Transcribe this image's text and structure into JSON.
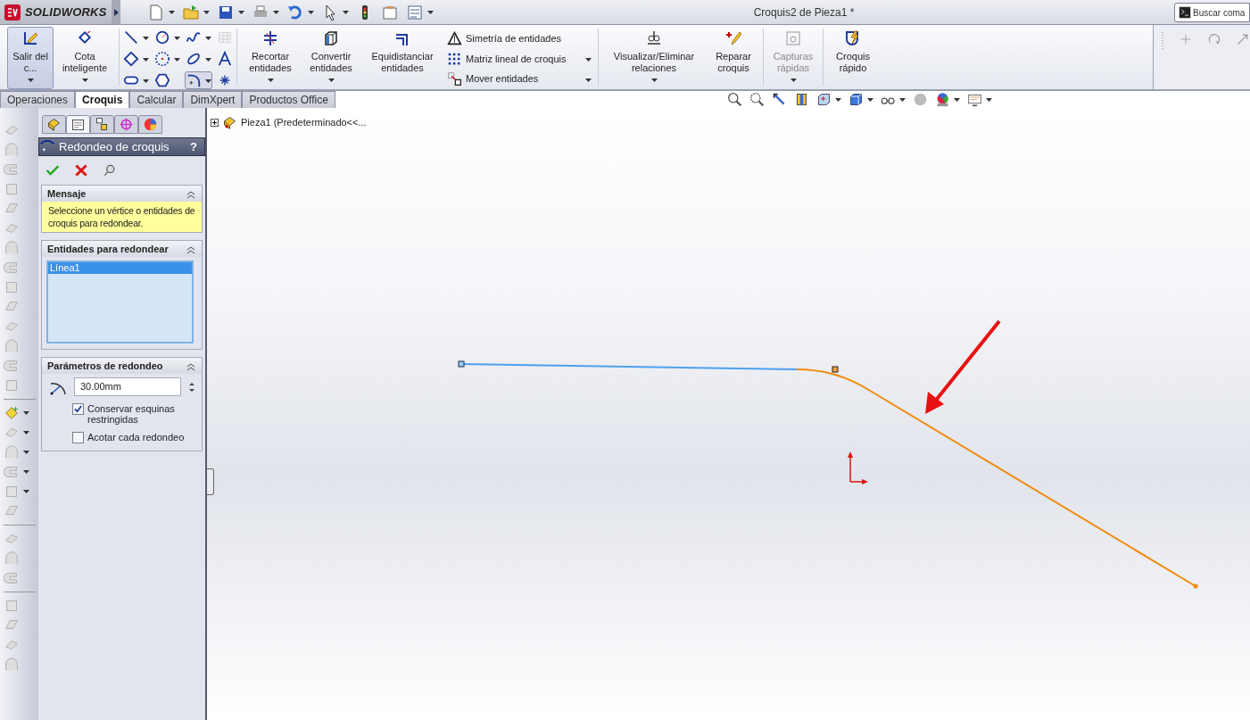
{
  "app": {
    "logo": "SOLIDWORKS"
  },
  "window": {
    "title": "Croquis2 de Pieza1 *"
  },
  "search": {
    "placeholder": "Buscar coma"
  },
  "ribbon": [
    {
      "kind": "large",
      "label": "Salir del c...",
      "pressed": true,
      "dropdown": true
    },
    {
      "kind": "large",
      "label": "Cota inteligente",
      "pressed": false,
      "dropdown": true
    },
    {
      "kind": "tools",
      "tools": [
        {
          "dropdown": true,
          "pressed": false
        },
        {
          "dropdown": true,
          "pressed": false
        },
        {
          "dropdown": true,
          "pressed": false
        },
        {
          "dropdown": false,
          "pressed": false
        },
        {
          "dropdown": true,
          "pressed": false
        },
        {
          "dropdown": true,
          "pressed": false
        },
        {
          "dropdown": true,
          "pressed": false
        },
        {
          "dropdown": false,
          "pressed": false
        },
        {
          "dropdown": true,
          "pressed": false
        },
        {
          "dropdown": false,
          "pressed": false
        },
        {
          "dropdown": true,
          "pressed": true
        },
        {
          "dropdown": false,
          "pressed": false
        }
      ]
    },
    {
      "kind": "large",
      "label": "Recortar entidades",
      "pressed": false,
      "dropdown": true
    },
    {
      "kind": "large",
      "label": "Convertir entidades",
      "pressed": false,
      "dropdown": true
    },
    {
      "kind": "large",
      "label": "Equidistanciar entidades",
      "pressed": false,
      "dropdown": false
    },
    {
      "kind": "list",
      "items": [
        {
          "label": "Simetría de entidades",
          "dropdown": false
        },
        {
          "label": "Matriz lineal de croquis",
          "dropdown": true
        },
        {
          "label": "Mover entidades",
          "dropdown": true
        }
      ]
    },
    {
      "kind": "large",
      "label": "Visualizar/Eliminar relaciones",
      "pressed": false,
      "dropdown": true
    },
    {
      "kind": "large",
      "label": "Reparar croquis",
      "pressed": false,
      "dropdown": false
    },
    {
      "kind": "large",
      "label": "Capturas rápidas",
      "pressed": false,
      "dropdown": true,
      "disabled": true
    },
    {
      "kind": "large",
      "label": "Croquis rápido",
      "pressed": false,
      "dropdown": false
    }
  ],
  "tabs": [
    {
      "label": "Operaciones",
      "selected": false
    },
    {
      "label": "Croquis",
      "selected": true
    },
    {
      "label": "Calcular",
      "selected": false
    },
    {
      "label": "DimXpert",
      "selected": false
    },
    {
      "label": "Productos Office",
      "selected": false
    }
  ],
  "tree": [
    {
      "label": "Pieza1  (Predeterminado<<...",
      "expanded": false
    }
  ],
  "property_manager": {
    "tabs": [
      {
        "selected": false
      },
      {
        "selected": true
      },
      {
        "selected": false
      },
      {
        "selected": false
      },
      {
        "selected": false
      }
    ],
    "title": "Redondeo de croquis",
    "help": "?",
    "sections": [
      {
        "kind": "message",
        "title": "Mensaje",
        "text": "Seleccione un vértice o entidades de croquis para redondear."
      },
      {
        "kind": "selection",
        "title": "Entidades para redondear",
        "items": [
          {
            "label": "Línea1",
            "selected": true
          }
        ]
      },
      {
        "kind": "parameters",
        "title": "Parámetros de redondeo",
        "radius": "30.00mm",
        "options": [
          {
            "label": "Conservar esquinas restringidas",
            "checked": true
          },
          {
            "label": "Acotar cada redondeo",
            "checked": false
          }
        ]
      }
    ]
  }
}
